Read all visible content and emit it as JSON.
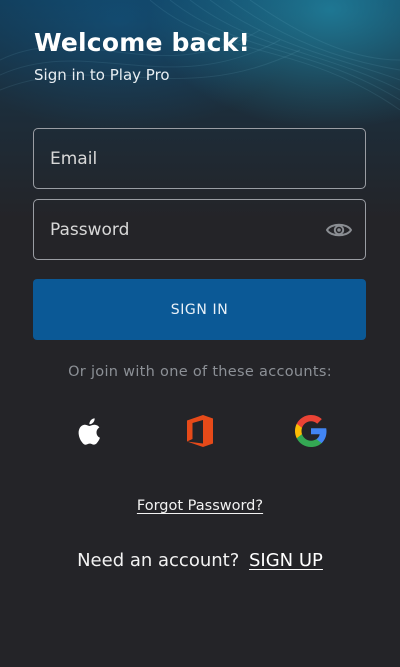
{
  "header": {
    "title": "Welcome back!",
    "subtitle": "Sign in to Play Pro"
  },
  "form": {
    "email_placeholder": "Email",
    "email_value": "",
    "password_placeholder": "Password",
    "password_value": "",
    "password_toggle_icon": "eye-icon",
    "submit_label": "SIGN IN"
  },
  "social": {
    "prompt": "Or join with one of these accounts:",
    "providers": [
      {
        "name": "Apple",
        "icon": "apple-icon"
      },
      {
        "name": "Office",
        "icon": "office-icon"
      },
      {
        "name": "Google",
        "icon": "google-icon"
      }
    ]
  },
  "footer": {
    "forgot_password": "Forgot Password?",
    "need_account": "Need an account?",
    "sign_up": "SIGN UP"
  },
  "colors": {
    "background": "#242428",
    "primary_button": "#0b5996",
    "muted_text": "#8c9096",
    "field_border": "#9a9da3",
    "office_orange": "#e64a19"
  }
}
